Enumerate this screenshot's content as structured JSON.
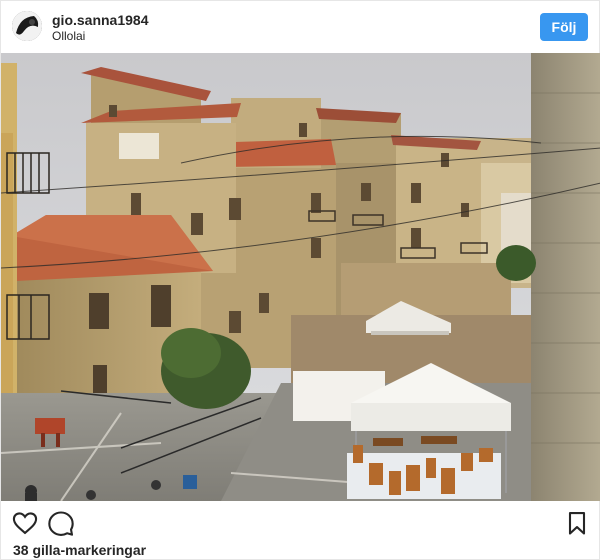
{
  "post": {
    "username": "gio.sanna1984",
    "location": "Ollolai",
    "follow_label": "Följ",
    "likes_text": "38 gilla-markeringar"
  },
  "icons": {
    "like": "heart-icon",
    "comment": "comment-icon",
    "save": "bookmark-icon"
  },
  "colors": {
    "accent": "#3897f0",
    "text": "#262626"
  }
}
